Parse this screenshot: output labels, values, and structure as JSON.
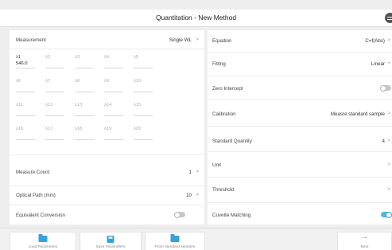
{
  "window": {
    "title": "Quantitation - New Method",
    "menu_icon": "menu-icon"
  },
  "left": {
    "measurement": {
      "label": "Measurement",
      "value": "Single WL",
      "arrow": ">"
    },
    "wavelengths": [
      {
        "name": "λ1",
        "value": "546.0"
      },
      {
        "name": "λ2",
        "value": ""
      },
      {
        "name": "λ3",
        "value": ""
      },
      {
        "name": "λ4",
        "value": ""
      },
      {
        "name": "λ5",
        "value": ""
      },
      {
        "name": "λ6",
        "value": ""
      },
      {
        "name": "λ7",
        "value": ""
      },
      {
        "name": "λ8",
        "value": ""
      },
      {
        "name": "λ9",
        "value": ""
      },
      {
        "name": "λ10",
        "value": ""
      },
      {
        "name": "λ11",
        "value": ""
      },
      {
        "name": "λ12",
        "value": ""
      },
      {
        "name": "λ13",
        "value": ""
      },
      {
        "name": "λ14",
        "value": ""
      },
      {
        "name": "λ15",
        "value": ""
      },
      {
        "name": "λ16",
        "value": ""
      },
      {
        "name": "λ17",
        "value": ""
      },
      {
        "name": "λ18",
        "value": ""
      },
      {
        "name": "λ19",
        "value": ""
      },
      {
        "name": "λ20",
        "value": ""
      }
    ],
    "measure_count": {
      "label": "Measure Count",
      "value": "1",
      "arrow": ">"
    },
    "optical_path": {
      "label": "Optical Path (mm)",
      "value": "10",
      "arrow": ">"
    },
    "equivalent_conversion": {
      "label": "Equivalent Conversion",
      "state": "off"
    }
  },
  "right": {
    "equation": {
      "label": "Equation",
      "value": "C=f(Abs)",
      "arrow": ">"
    },
    "fitting": {
      "label": "Fitting",
      "value": "Linear",
      "arrow": ">"
    },
    "zero_intercept": {
      "label": "Zero Intercept",
      "state": "off"
    },
    "calibration": {
      "label": "Calibration",
      "value": "Measre standard sample",
      "arrow": ">"
    },
    "standard_quantity": {
      "label": "Standard Quantity",
      "value": "4",
      "arrow": ">"
    },
    "unit": {
      "label": "Unit",
      "value": "",
      "arrow": ">"
    },
    "threshold": {
      "label": "Threshold",
      "value": "",
      "arrow": ">"
    },
    "cuvette_matching": {
      "label": "Cuvette Matching",
      "state": "on"
    }
  },
  "bottom": {
    "load": "Load Parameters",
    "save": "Save Parameters",
    "from_standard": "From standard samples",
    "next": "Next",
    "next_arrow": "→"
  },
  "colors": {
    "accent": "#3aa0dc",
    "toggle_on": "#4cb8e0",
    "background": "#eeeeee"
  }
}
